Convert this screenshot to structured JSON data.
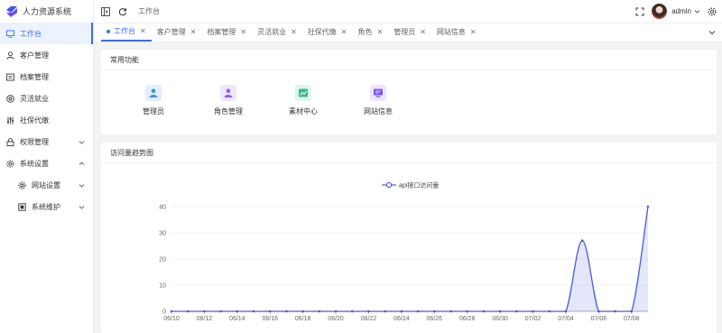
{
  "app": {
    "title": "人力资源系统"
  },
  "sidebar": {
    "items": [
      {
        "label": "工作台",
        "icon": "monitor-icon",
        "active": true
      },
      {
        "label": "客户管理",
        "icon": "user-icon"
      },
      {
        "label": "档案管理",
        "icon": "archive-icon"
      },
      {
        "label": "灵活就业",
        "icon": "lifebuoy-icon"
      },
      {
        "label": "社保代缴",
        "icon": "sliders-icon"
      },
      {
        "label": "权限管理",
        "icon": "lock-icon",
        "expandable": true
      },
      {
        "label": "系统设置",
        "icon": "settings-icon",
        "expanded": true
      },
      {
        "label": "网站设置",
        "icon": "gear-icon",
        "sub": true,
        "expandable": true
      },
      {
        "label": "系统维护",
        "icon": "maintenance-icon",
        "sub": true,
        "expandable": true
      }
    ]
  },
  "header": {
    "breadcrumb": "工作台",
    "username": "admin"
  },
  "tabs": [
    {
      "label": "工作台",
      "active": true
    },
    {
      "label": "客户管理"
    },
    {
      "label": "档案管理"
    },
    {
      "label": "灵活就业"
    },
    {
      "label": "社保代缴"
    },
    {
      "label": "角色"
    },
    {
      "label": "管理员"
    },
    {
      "label": "网站信息"
    }
  ],
  "quick": {
    "title": "常用功能",
    "items": [
      {
        "label": "管理员",
        "color": "#e6f1ff",
        "icon": "admin-icon"
      },
      {
        "label": "角色管理",
        "color": "#efe8ff",
        "icon": "role-icon"
      },
      {
        "label": "素材中心",
        "color": "#e3f6ef",
        "icon": "media-icon"
      },
      {
        "label": "网站信息",
        "color": "#eee8ff",
        "icon": "website-icon"
      }
    ]
  },
  "visits": {
    "title": "访问量趋势图"
  },
  "colors": {
    "accent": "#3b6cf5",
    "line": "#4a5bdc"
  },
  "chart_data": {
    "type": "line",
    "smooth": true,
    "area": true,
    "legend": "top-center",
    "grid": true,
    "series": [
      {
        "name": "api接口访问量",
        "values": [
          0,
          0,
          0,
          0,
          0,
          0,
          0,
          0,
          0,
          0,
          0,
          0,
          0,
          0,
          0,
          0,
          0,
          0,
          0,
          0,
          0,
          0,
          0,
          0,
          0,
          27,
          0,
          0,
          0,
          40
        ]
      }
    ],
    "x": [
      "06/10",
      "06/11",
      "06/12",
      "06/13",
      "06/14",
      "06/15",
      "06/16",
      "06/17",
      "06/18",
      "06/19",
      "06/20",
      "06/21",
      "06/22",
      "06/23",
      "06/24",
      "06/25",
      "06/26",
      "06/27",
      "06/28",
      "06/29",
      "06/30",
      "07/01",
      "07/02",
      "07/03",
      "07/04",
      "07/05",
      "07/06",
      "07/07",
      "07/08",
      "07/09"
    ],
    "xticks": [
      "06/10",
      "06/12",
      "06/14",
      "06/16",
      "06/18",
      "06/20",
      "06/22",
      "06/24",
      "06/26",
      "06/28",
      "06/30",
      "07/02",
      "07/04",
      "07/06",
      "07/08"
    ],
    "yticks": [
      0,
      10,
      20,
      30,
      40
    ],
    "ylim": [
      0,
      40
    ]
  }
}
